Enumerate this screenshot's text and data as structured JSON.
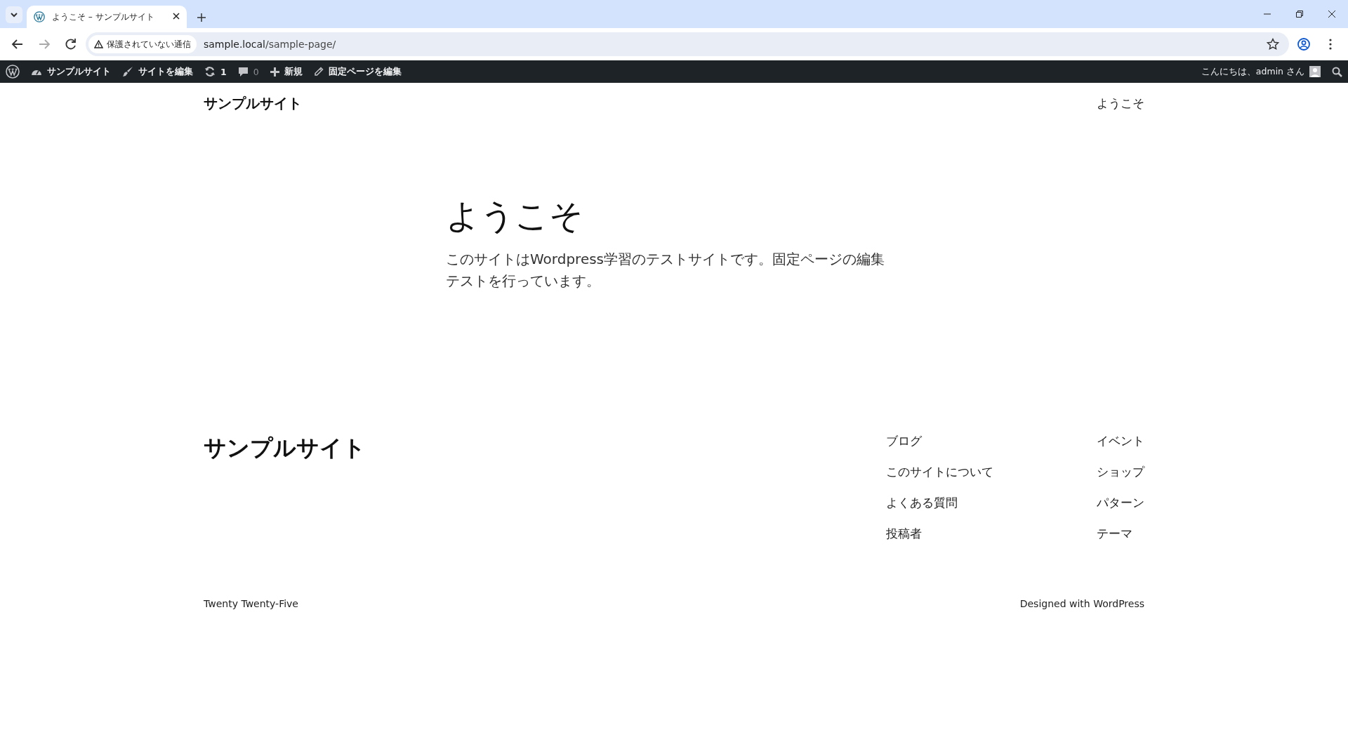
{
  "browser": {
    "tabs": [
      {
        "title": "ようこそ – サンプルサイト",
        "selected": true
      }
    ],
    "address": {
      "security_label": "保護されていない通信",
      "host": "sample.local",
      "path": "/sample-page/"
    }
  },
  "admin_bar": {
    "items": [
      {
        "kind": "logo"
      },
      {
        "kind": "site",
        "label": "サンプルサイト"
      },
      {
        "kind": "edit-site",
        "label": "サイトを編集"
      },
      {
        "kind": "updates",
        "label": "1"
      },
      {
        "kind": "comments",
        "label": "0"
      },
      {
        "kind": "new",
        "label": "新規"
      },
      {
        "kind": "edit-page",
        "label": "固定ページを編集"
      }
    ],
    "greeting": "こんにちは、admin さん"
  },
  "header": {
    "site_title": "サンプルサイト",
    "nav": [
      "ようこそ"
    ]
  },
  "content": {
    "title": "ようこそ",
    "body": "このサイトはWordpress学習のテストサイトです。固定ページの編集テストを行っています。"
  },
  "footer": {
    "site_title": "サンプルサイト",
    "nav_columns": [
      [
        "ブログ",
        "このサイトについて",
        "よくある質問",
        "投稿者"
      ],
      [
        "イベント",
        "ショップ",
        "パターン",
        "テーマ"
      ]
    ],
    "theme_name": "Twenty Twenty-Five",
    "credit_prefix": "Designed with",
    "credit_link": "WordPress"
  }
}
